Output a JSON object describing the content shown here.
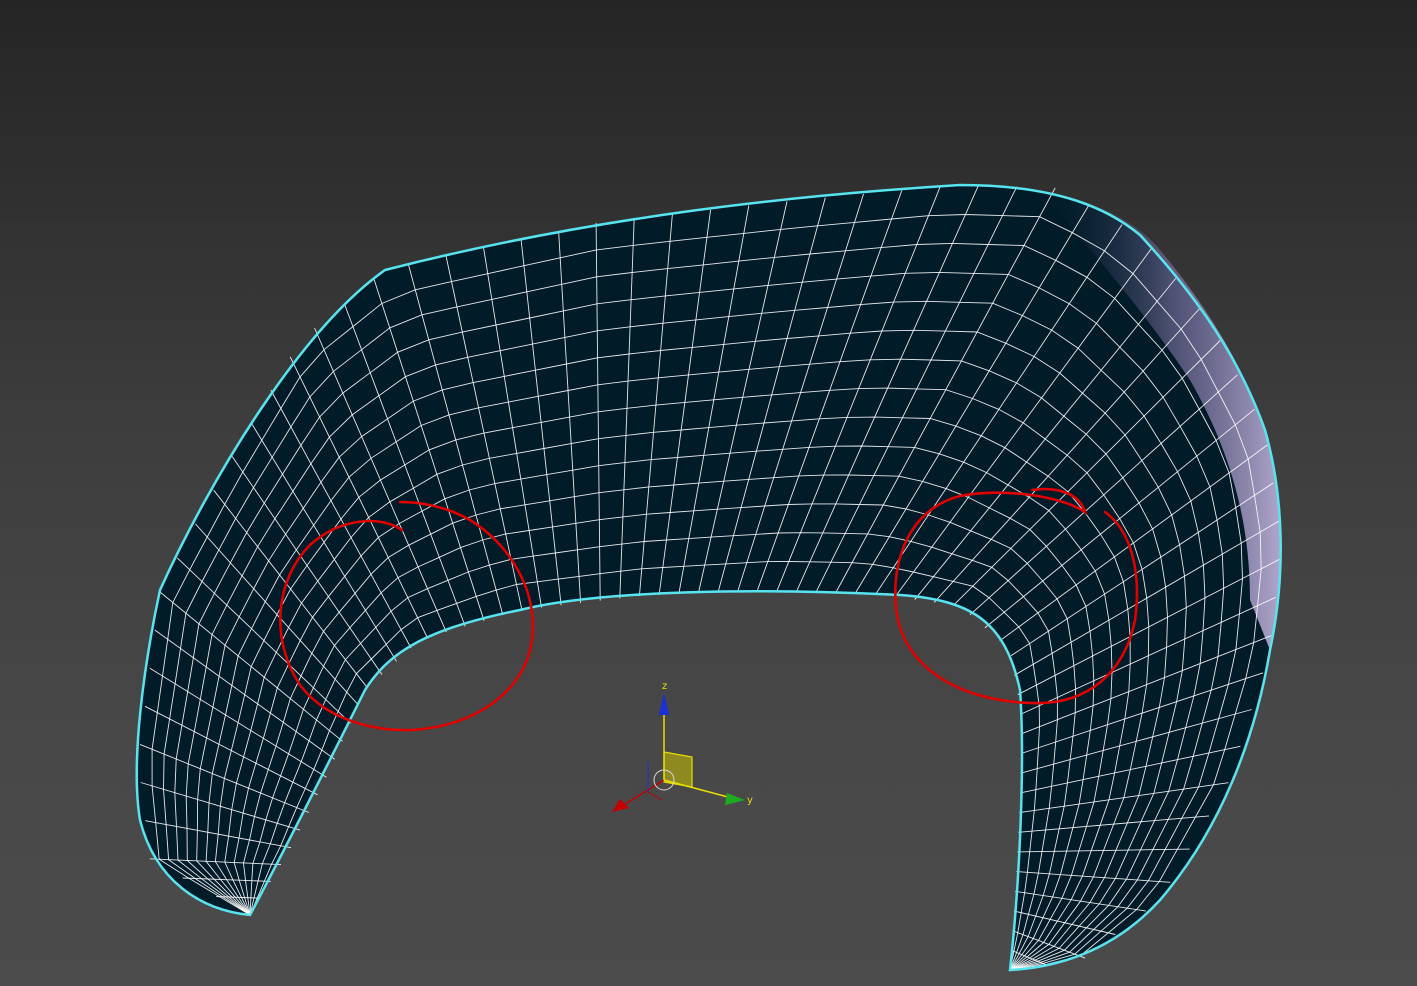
{
  "viewport": {
    "background_top": "#252525",
    "background_bottom": "#4b4b4b"
  },
  "mesh": {
    "fill": "#021b29",
    "wire": "#ffffff",
    "outline": "#58e4ef",
    "shade": "#b9a8d6"
  },
  "annotations": {
    "color": "#e00000",
    "count": 2
  },
  "gizmo": {
    "x_color": "#c40000",
    "y_color": "#1faa1f",
    "z_color": "#1b2fd6",
    "plane_color": "#c9c000",
    "y_label": "y",
    "z_label": "z"
  }
}
